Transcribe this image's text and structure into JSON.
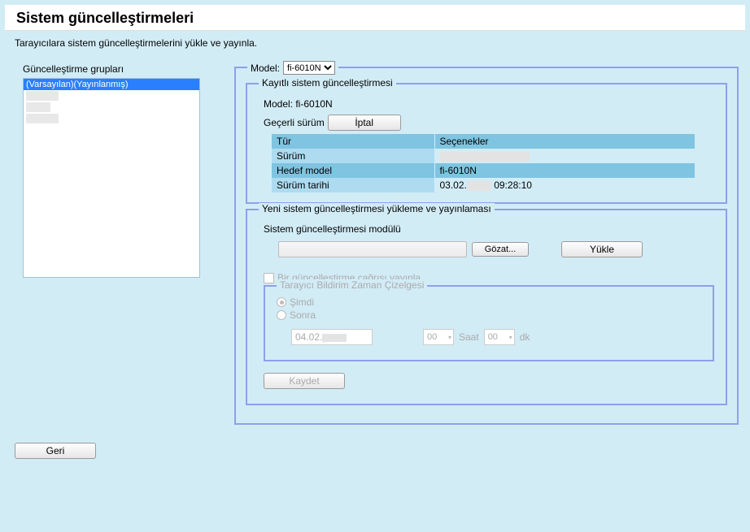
{
  "title": "Sistem güncelleştirmeleri",
  "subtitle": "Tarayıcılara sistem güncelleştirmelerini yükle ve yayınla.",
  "groups": {
    "label": "Güncelleştirme grupları",
    "items": [
      "(Varsayılan)(Yayınlanmış)",
      "",
      "",
      ""
    ]
  },
  "model": {
    "label": "Model:",
    "selected": "fi-6010N"
  },
  "registered": {
    "legend": "Kayıtlı sistem güncelleştirmesi",
    "model_label": "Model: fi-6010N",
    "current_label": "Geçerli sürüm",
    "cancel_btn": "İptal",
    "rows": {
      "type_k": "Tür",
      "type_v": "Seçenekler",
      "version_k": "Sürüm",
      "version_v": "",
      "target_k": "Hedef model",
      "target_v": "fi-6010N",
      "date_k": "Sürüm tarihi",
      "date_v_pre": "03.02.",
      "date_v_post": " 09:28:10"
    }
  },
  "upload": {
    "legend": "Yeni sistem güncelleştirmesi yükleme ve yayınlaması",
    "module_label": "Sistem güncelleştirmesi modülü",
    "browse_btn": "Gözat...",
    "upload_btn": "Yükle",
    "publish_chk": "Bir güncelleştirme çağrısı yayınla",
    "schedule": {
      "legend": "Tarayıcı Bildirim Zaman Çizelgesi",
      "now": "Şimdi",
      "later": "Sonra",
      "date": "04.02.",
      "hh": "00",
      "hh_unit": "Saat",
      "mm": "00",
      "mm_unit": "dk"
    },
    "save_btn": "Kaydet"
  },
  "back_btn": "Geri"
}
